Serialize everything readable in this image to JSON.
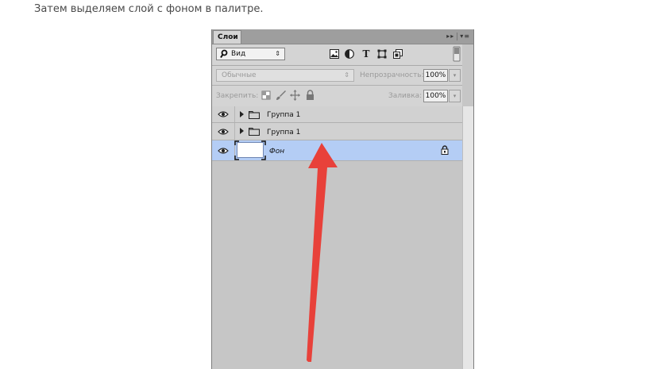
{
  "caption": "Затем выделяем слой с фоном в палитре.",
  "panel": {
    "tab_label": "Слои",
    "tab_tools_left": "▸▸",
    "tab_tools_right": "▾≡"
  },
  "filter": {
    "kind_label": "Вид",
    "arrow": "⇕",
    "icons": [
      "image-filter-icon",
      "adjustment-filter-icon",
      "type-filter-icon",
      "shape-filter-icon",
      "smart-object-filter-icon"
    ],
    "type_glyph": "T"
  },
  "blend": {
    "mode_label": "Обычные",
    "arrow": "⇕",
    "opacity_label": "Непрозрачность:",
    "opacity_value": "100%",
    "dropdown_glyph": "▾"
  },
  "lock": {
    "label": "Закрепить:",
    "icons": [
      "lock-transparent-pixels-icon",
      "lock-image-pixels-icon",
      "lock-position-icon",
      "lock-all-icon"
    ],
    "fill_label": "Заливка:",
    "fill_value": "100%",
    "dropdown_glyph": "▾"
  },
  "layers": [
    {
      "name": "Группа 1",
      "type": "group",
      "visible": true,
      "selected": false
    },
    {
      "name": "Группа 1",
      "type": "group",
      "visible": true,
      "selected": false
    },
    {
      "name": "Фон",
      "type": "background",
      "visible": true,
      "selected": true,
      "locked": true
    }
  ],
  "colors": {
    "selection": "#b4cdf5",
    "panel_bg": "#c6c6c6",
    "arrow": "#e8413a"
  }
}
